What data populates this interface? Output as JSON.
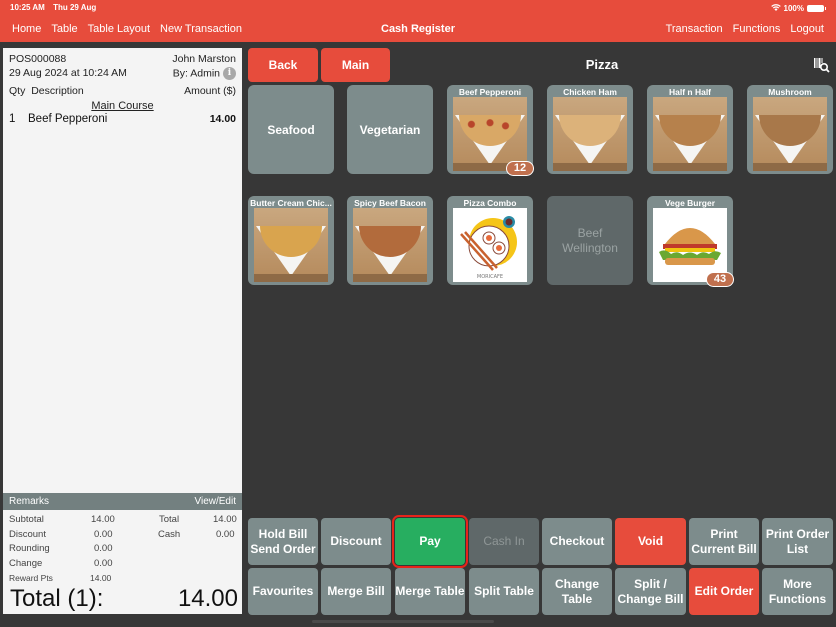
{
  "status_bar": {
    "time": "10:25 AM",
    "date": "Thu 29 Aug",
    "battery": "100%"
  },
  "nav": {
    "left": [
      "Home",
      "Table",
      "Table Layout",
      "New Transaction"
    ],
    "title": "Cash Register",
    "right": [
      "Transaction",
      "Functions",
      "Logout"
    ]
  },
  "receipt": {
    "order_no": "POS000088",
    "customer": "John Marston",
    "datetime": "29 Aug 2024 at 10:24 AM",
    "by": "By: Admin",
    "col_qty": "Qty",
    "col_desc": "Description",
    "col_amount": "Amount ($)",
    "section": "Main Course",
    "items": [
      {
        "qty": "1",
        "desc": "Beef Pepperoni",
        "amount": "14.00"
      }
    ],
    "remarks_label": "Remarks",
    "remarks_action": "View/Edit",
    "totals": {
      "subtotal_label": "Subtotal",
      "subtotal": "14.00",
      "discount_label": "Discount",
      "discount": "0.00",
      "rounding_label": "Rounding",
      "rounding": "0.00",
      "change_label": "Change",
      "change": "0.00",
      "reward_label": "Reward Pts",
      "reward": "14.00",
      "total_label": "Total",
      "total": "14.00",
      "cash_label": "Cash",
      "cash": "0.00"
    },
    "grand_label": "Total (1):",
    "grand_value": "14.00"
  },
  "menu": {
    "back": "Back",
    "main": "Main",
    "category": "Pizza",
    "categories": [
      "Seafood",
      "Vegetarian"
    ],
    "products": [
      {
        "name": "Beef Pepperoni",
        "badge": "12"
      },
      {
        "name": "Chicken Ham"
      },
      {
        "name": "Half n Half"
      },
      {
        "name": "Mushroom"
      },
      {
        "name": "Butter Cream Chic..."
      },
      {
        "name": "Spicy Beef Bacon"
      },
      {
        "name": "Pizza Combo",
        "image_caption": "MORICAFE"
      },
      {
        "name": "Beef Wellington"
      },
      {
        "name": "Vege Burger",
        "badge": "43"
      }
    ]
  },
  "actions": {
    "row1": [
      "Hold Bill\nSend Order",
      "Discount",
      "Pay",
      "Cash In",
      "Checkout",
      "Void",
      "Print\nCurrent Bill",
      "Print Order\nList"
    ],
    "row2": [
      "Favourites",
      "Merge Bill",
      "Merge Table",
      "Split Table",
      "Change\nTable",
      "Split /\nChange Bill",
      "Edit Order",
      "More\nFunctions"
    ]
  },
  "colors": {
    "brand": "#e74c3c",
    "pay": "#27ae60",
    "tile": "#7d8c8c",
    "badge": "#c0704e"
  }
}
